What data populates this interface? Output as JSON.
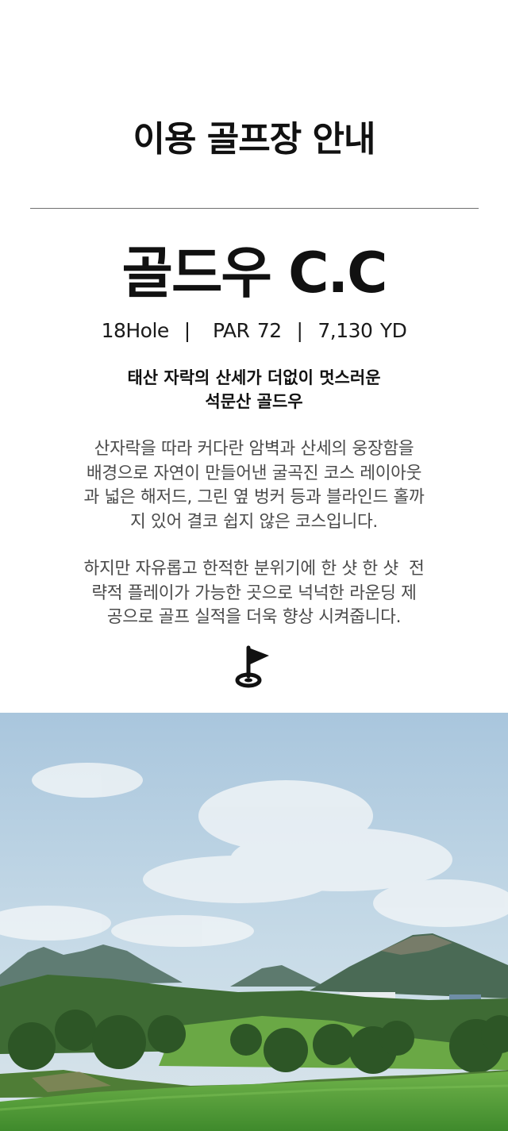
{
  "section": {
    "title": "이용 골프장 안내"
  },
  "course": {
    "name": "골드우 C.C",
    "stats": "18Hole  |   PAR 72  |  7,130 YD",
    "tagline_line1": "태산 자락의 산세가 더없이 멋스러운",
    "tagline_line2": "석문산 골드우"
  },
  "description": {
    "p1_line1": "산자락을 따라 커다란 암벽과 산세의 웅장함을",
    "p1_line2": "배경으로 자연이 만들어낸 굴곡진 코스 레이아웃",
    "p1_line3": "과 넓은 해저드, 그린 옆 벙커 등과 블라인드 홀까",
    "p1_line4": "지 있어 결코 쉽지 않은 코스입니다.",
    "p2_line1": "하지만 자유롭고 한적한 분위기에 한 샷 한 샷  전",
    "p2_line2": "략적 플레이가 가능한 곳으로 넉넉한 라운딩 제",
    "p2_line3": "공으로 골프 실적을 더욱 향상 시켜줍니다."
  },
  "icons": {
    "flag": "golf-flag-icon"
  },
  "photo": {
    "subject": "golf course landscape",
    "colors": {
      "sky": "#aecbe0",
      "mountain": "#4f6f5a",
      "fairway": "#5fa83f",
      "trees": "#2f5a2a"
    }
  }
}
